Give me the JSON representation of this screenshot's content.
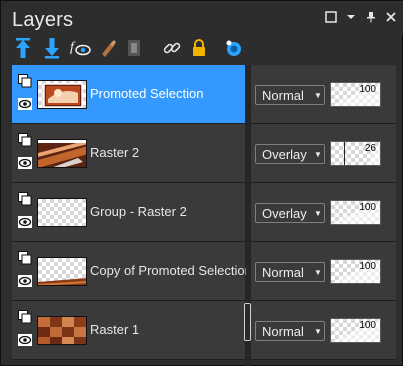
{
  "panel": {
    "title": "Layers",
    "title_buttons": [
      {
        "name": "panel-menu-icon",
        "glyph": "▢"
      },
      {
        "name": "dropdown-icon",
        "glyph": "▾"
      },
      {
        "name": "pin-icon",
        "glyph": "📌"
      },
      {
        "name": "close-icon",
        "glyph": "✕"
      }
    ]
  },
  "toolbar": {
    "tools": [
      {
        "name": "move-layer-up-icon"
      },
      {
        "name": "move-layer-down-icon"
      },
      {
        "name": "layer-visibility-icon"
      },
      {
        "name": "edit-brush-icon"
      },
      {
        "name": "mask-icon"
      },
      {
        "name": "link-icon"
      },
      {
        "name": "lock-icon"
      },
      {
        "name": "color-picker-icon"
      }
    ]
  },
  "layers": [
    {
      "name": "Promoted Selection",
      "blend": "Normal",
      "opacity": 100,
      "selected": true,
      "thumb": "photo-a"
    },
    {
      "name": "Raster 2",
      "blend": "Overlay",
      "opacity": 26,
      "selected": false,
      "thumb": "photo-b"
    },
    {
      "name": "Group - Raster 2",
      "blend": "Overlay",
      "opacity": 100,
      "selected": false,
      "thumb": "checker"
    },
    {
      "name": "Copy of Promoted Selection",
      "blend": "Normal",
      "opacity": 100,
      "selected": false,
      "thumb": "strip"
    },
    {
      "name": "Raster 1",
      "blend": "Normal",
      "opacity": 100,
      "selected": false,
      "thumb": "photo-c"
    }
  ],
  "colors": {
    "selected_row": "#3399ff",
    "row_bg": "#3a3a3a",
    "panel_bg": "#2d2d2d"
  }
}
